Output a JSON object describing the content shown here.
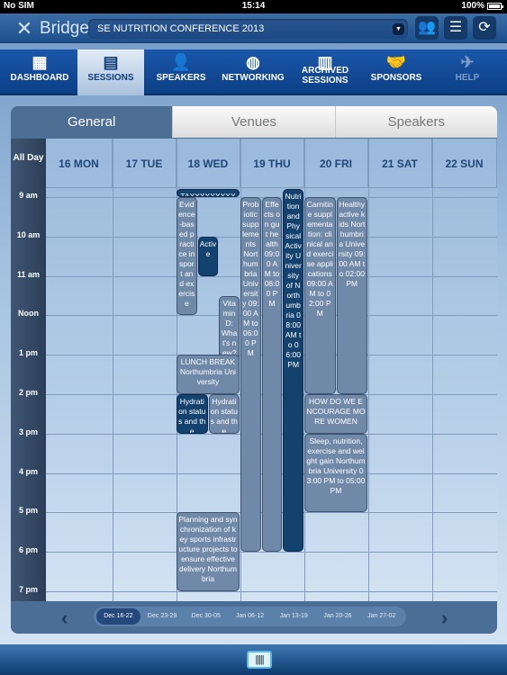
{
  "status_bar": {
    "carrier": "No SIM",
    "time": "15:14",
    "battery": "100%"
  },
  "top_bar": {
    "brand": "Bridge",
    "conference": "SE NUTRITION CONFERENCE 2013"
  },
  "nav": [
    {
      "label": "DASHBOARD",
      "icon": "dashboard-icon",
      "glyph": "▦"
    },
    {
      "label": "SESSIONS",
      "icon": "calendar-icon",
      "glyph": "▤",
      "active": true
    },
    {
      "label": "SPEAKERS",
      "icon": "speaker-search-icon",
      "glyph": "👤"
    },
    {
      "label": "NETWORKING",
      "icon": "globe-icon",
      "glyph": "◍"
    },
    {
      "label": "ARCHIVED SESSIONS",
      "icon": "cabinet-icon",
      "glyph": "▥"
    },
    {
      "label": "SPONSORS",
      "icon": "handshake-icon",
      "glyph": "🤝"
    },
    {
      "label": "HELP",
      "icon": "help-plane-icon",
      "glyph": "✈",
      "disabled": true
    }
  ],
  "tabs": [
    {
      "label": "General",
      "active": true
    },
    {
      "label": "Venues"
    },
    {
      "label": "Speakers"
    }
  ],
  "all_day_label": "All Day",
  "days": [
    "16 MON",
    "17 TUE",
    "18 WED",
    "19 THU",
    "20 FRI",
    "21 SAT",
    "22 SUN"
  ],
  "time_labels": [
    "9 am",
    "10 am",
    "11 am",
    "Noon",
    "1 pm",
    "2 pm",
    "3 pm",
    "4 pm",
    "5 pm",
    "6 pm",
    "7 pm"
  ],
  "events": [
    {
      "title": "TAXXXXXXXXX",
      "day": 1,
      "start": 8.75,
      "end": 9.0,
      "lane": 0,
      "lanes": 1,
      "dark": true
    },
    {
      "title": "Evidence-based practice in sport and exercise",
      "day": 1,
      "start": 9.0,
      "end": 12.0,
      "lane": 0,
      "lanes": 3,
      "dark": false
    },
    {
      "title": "Active",
      "day": 1,
      "start": 10.0,
      "end": 11.0,
      "lane": 1,
      "lanes": 3,
      "dark": true
    },
    {
      "title": "Vitamin D: What's new?",
      "day": 1,
      "start": 11.5,
      "end": 13.5,
      "lane": 2,
      "lanes": 3,
      "dark": false
    },
    {
      "title": "LUNCH BREAK Northumbria University",
      "day": 1,
      "start": 13.0,
      "end": 14.0,
      "lane": 0,
      "lanes": 1,
      "dark": false
    },
    {
      "title": "Hydration status and the",
      "day": 1,
      "start": 14.0,
      "end": 15.0,
      "lane": 0,
      "lanes": 2,
      "dark": true
    },
    {
      "title": "Hydration status and the",
      "day": 1,
      "start": 14.0,
      "end": 15.0,
      "lane": 1,
      "lanes": 2,
      "dark": false
    },
    {
      "title": "Planning and synchronization of key sports infrastructure projects to ensure effective delivery Northumbria",
      "day": 1,
      "start": 17.0,
      "end": 19.0,
      "lane": 0,
      "lanes": 1,
      "dark": false
    },
    {
      "title": "Probiotic supplements Northumbria University 09:00 AM to 06:00 PM",
      "day": 2,
      "start": 9.0,
      "end": 18.0,
      "lane": 0,
      "lanes": 3,
      "dark": false
    },
    {
      "title": "Effects on gut health 09:00 AM to 06:00 PM",
      "day": 2,
      "start": 9.0,
      "end": 18.0,
      "lane": 1,
      "lanes": 3,
      "dark": false
    },
    {
      "title": "Nutrition and Physical Activity University of Northumbria 08:00 AM to 06:00 PM",
      "day": 2,
      "start": 8.75,
      "end": 18.0,
      "lane": 2,
      "lanes": 3,
      "dark": true
    },
    {
      "title": "Carnitine supplementation: clinical and exercise applications 09:00 AM to 02:00 PM",
      "day": 3,
      "start": 9.0,
      "end": 14.0,
      "lane": 0,
      "lanes": 2,
      "dark": false
    },
    {
      "title": "Healthy active kids Northumbria University 09:00 AM to 02:00 PM",
      "day": 3,
      "start": 9.0,
      "end": 14.0,
      "lane": 1,
      "lanes": 2,
      "dark": false
    },
    {
      "title": "HOW DO WE ENCOURAGE MORE WOMEN",
      "day": 3,
      "start": 14.0,
      "end": 15.0,
      "lane": 0,
      "lanes": 1,
      "dark": false
    },
    {
      "title": "Sleep, nutrition, exercise and weight gain Northumbria University 03:00 PM to 05:00 PM",
      "day": 3,
      "start": 15.0,
      "end": 17.0,
      "lane": 0,
      "lanes": 1,
      "dark": false
    }
  ],
  "weeks": [
    "Dec 16-22",
    "Dec 23-29",
    "Dec 30-05",
    "Jan 06-12",
    "Jan 13-19",
    "Jan 20-26",
    "Jan 27-02"
  ],
  "active_week": 0
}
